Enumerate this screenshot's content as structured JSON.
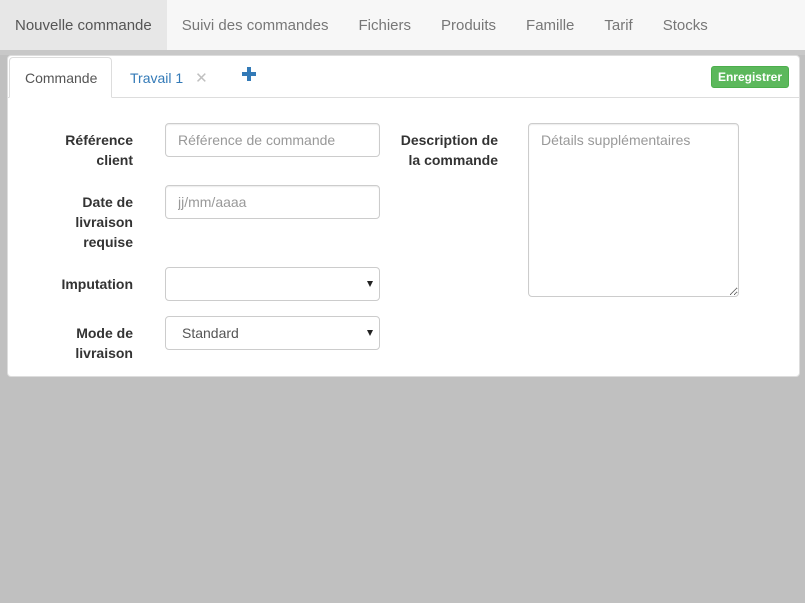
{
  "nav": {
    "items": [
      {
        "label": "Nouvelle commande",
        "active": true
      },
      {
        "label": "Suivi des commandes",
        "active": false
      },
      {
        "label": "Fichiers",
        "active": false
      },
      {
        "label": "Produits",
        "active": false
      },
      {
        "label": "Famille",
        "active": false
      },
      {
        "label": "Tarif",
        "active": false
      },
      {
        "label": "Stocks",
        "active": false
      }
    ]
  },
  "tabs": {
    "active_label": "Commande",
    "second_label": "Travail 1",
    "close_glyph": "✕",
    "add_icon": "plus-icon",
    "link_color": "#337ab7"
  },
  "toolbar": {
    "save_label": "Enregistrer",
    "save_color": "#5cb85c"
  },
  "form": {
    "reference": {
      "label_line1": "Référence",
      "label_line2": "client",
      "value": "",
      "placeholder": "Référence de commande"
    },
    "delivery_date": {
      "label_line1": "Date de",
      "label_line2": "livraison",
      "label_line3": "requise",
      "value": "",
      "placeholder": "jj/mm/aaaa"
    },
    "imputation": {
      "label": "Imputation",
      "value": ""
    },
    "delivery_mode": {
      "label_line1": "Mode de",
      "label_line2": "livraison",
      "value": "Standard"
    },
    "description": {
      "label_line1": "Description de",
      "label_line2": "la commande",
      "value": "",
      "placeholder": "Détails supplémentaires"
    }
  }
}
